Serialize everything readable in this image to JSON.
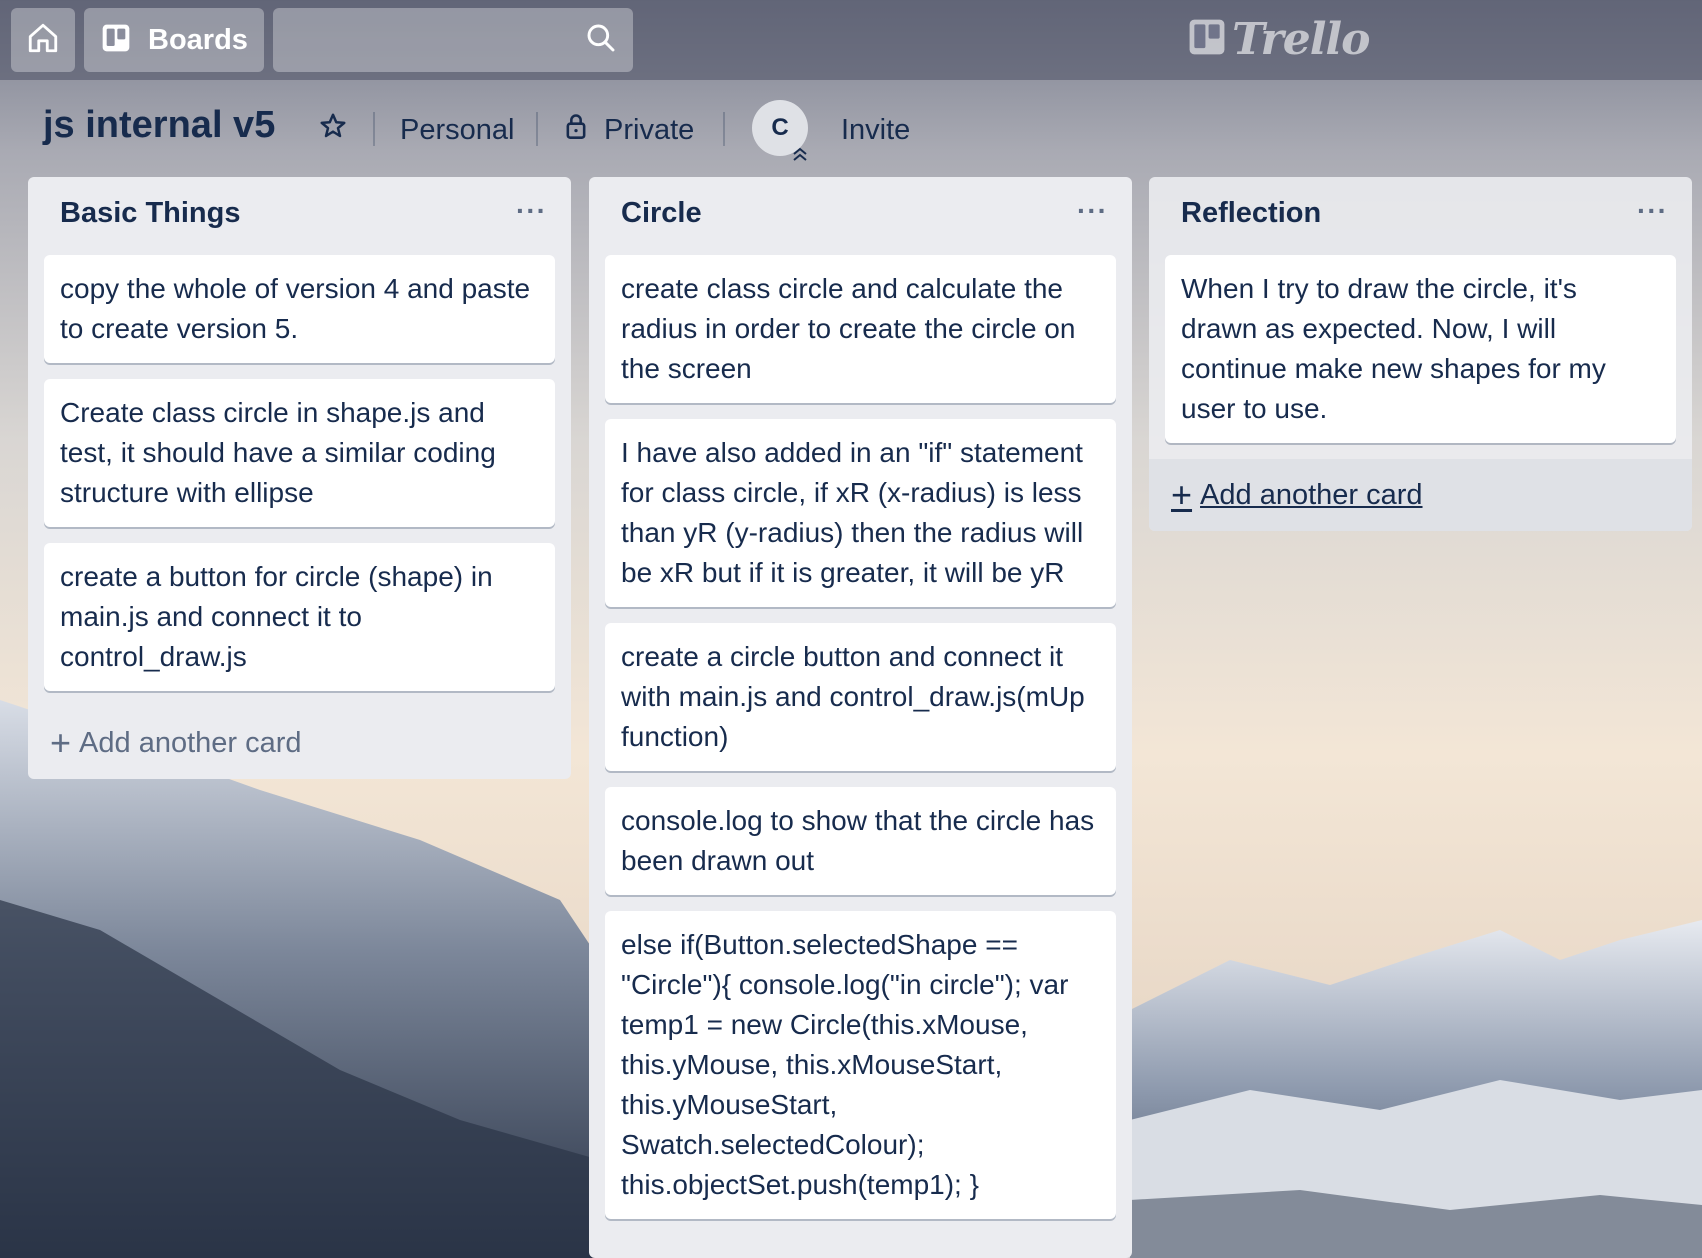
{
  "header": {
    "boards_label": "Boards",
    "search_placeholder": "",
    "logo_text": "Trello"
  },
  "board": {
    "title": "js internal v5",
    "team": "Personal",
    "visibility": "Private",
    "member_initial": "C",
    "invite_label": "Invite"
  },
  "lists": [
    {
      "title": "Basic Things",
      "cards": [
        "copy the whole of version 4 and paste to create version 5.",
        "Create class circle in shape.js and test, it should have a similar coding structure with ellipse",
        "create a button for circle (shape) in main.js and connect it to control_draw.js"
      ],
      "add_label": "Add another card"
    },
    {
      "title": "Circle",
      "cards": [
        "create class circle and calculate the radius in order to create the circle on the screen",
        "I have also added in an \"if\" statement for class circle, if xR (x-radius) is less than yR (y-radius) then the radius will be xR but if it is greater, it will be yR",
        "create a circle button and connect it with main.js and control_draw.js(mUp function)",
        "console.log to show that the circle has been drawn out",
        "else if(Button.selectedShape == \"Circle\"){ console.log(\"in circle\"); var temp1 = new Circle(this.xMouse, this.yMouse, this.xMouseStart, this.yMouseStart, Swatch.selectedColour); this.objectSet.push(temp1); }"
      ],
      "add_label": ""
    },
    {
      "title": "Reflection",
      "cards": [
        "When I try to draw the circle, it's drawn as expected. Now, I will continue make new shapes for my user to use."
      ],
      "add_label": "Add another card"
    }
  ],
  "list_menu_label": "···",
  "icons": [
    "home-icon",
    "board-icon",
    "search-icon",
    "trello-logo-icon",
    "star-icon",
    "lock-icon",
    "admin-chevron-icon",
    "plus-icon"
  ],
  "colors": {
    "list_bg": "#ebecf0",
    "card_bg": "#ffffff",
    "text": "#172b4d",
    "muted": "#5e6c84"
  }
}
